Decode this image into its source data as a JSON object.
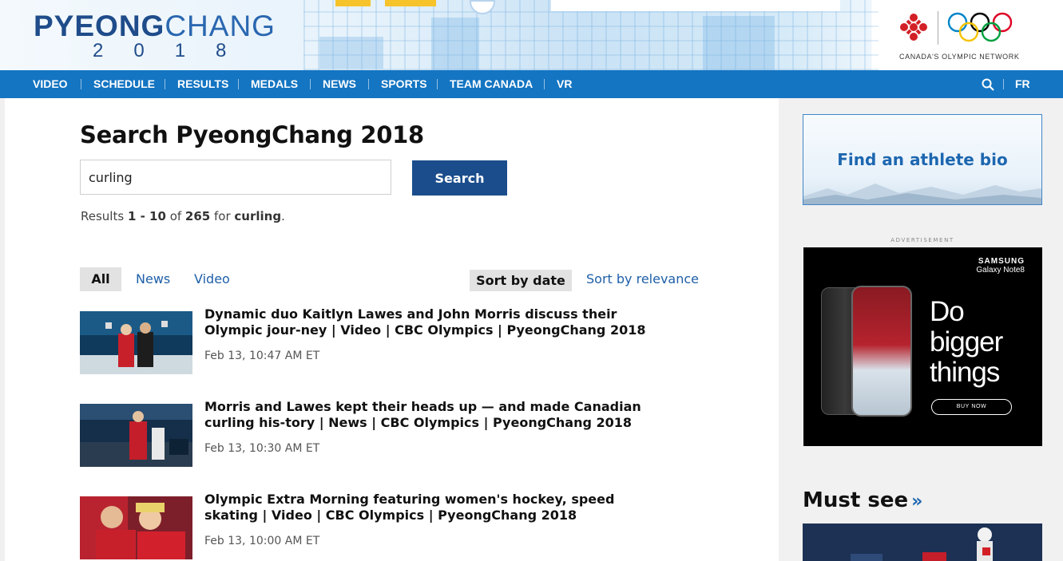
{
  "header": {
    "logo_word_bold": "PY",
    "logo_word_mid": "E",
    "logo_word_bold2": "ONG",
    "logo_word_light": "CHANG",
    "logo_year": "2018",
    "network_tagline": "CANADA'S OLYMPIC NETWORK"
  },
  "nav": {
    "items": [
      "VIDEO",
      "SCHEDULE",
      "RESULTS",
      "MEDALS",
      "NEWS",
      "SPORTS",
      "TEAM CANADA",
      "VR"
    ],
    "lang": "FR",
    "search_icon": "search-icon"
  },
  "search": {
    "title": "Search PyeongChang 2018",
    "query": "curling",
    "button": "Search",
    "results_prefix": "Results ",
    "range": "1 - 10",
    "of": " of ",
    "total": "265",
    "for": " for ",
    "term": "curling",
    "end": "."
  },
  "filters": {
    "all": "All",
    "news": "News",
    "video": "Video",
    "sort_date": "Sort by date",
    "sort_relevance": "Sort by relevance"
  },
  "results": [
    {
      "title": "Dynamic duo Kaitlyn Lawes and John Morris discuss their Olympic jour-ney | Video | CBC Olympics | PyeongChang 2018",
      "date": "Feb 13, 10:47 AM ET"
    },
    {
      "title": "Morris and Lawes kept their heads up — and made Canadian curling his-tory | News | CBC Olympics | PyeongChang 2018",
      "date": "Feb 13, 10:30 AM ET"
    },
    {
      "title": "Olympic Extra Morning featuring women's hockey, speed skating | Video | CBC Olympics | PyeongChang 2018",
      "date": "Feb 13, 10:00 AM ET"
    }
  ],
  "sidebar": {
    "athlete_bio": "Find an athlete bio",
    "ad_label": "ADVERTISEMENT",
    "ad_brand": "SAMSUNG",
    "ad_product": "Galaxy Note8",
    "ad_headline_1": "Do",
    "ad_headline_2": "bigger",
    "ad_headline_3": "things",
    "ad_cta": "BUY NOW",
    "must_see": "Must see",
    "must_see_chevron": "»"
  },
  "colors": {
    "nav_blue": "#1475c2",
    "button_blue": "#1b4d8c",
    "link_blue": "#1e5fa8",
    "sidebar_bg": "#f1f1f1"
  }
}
